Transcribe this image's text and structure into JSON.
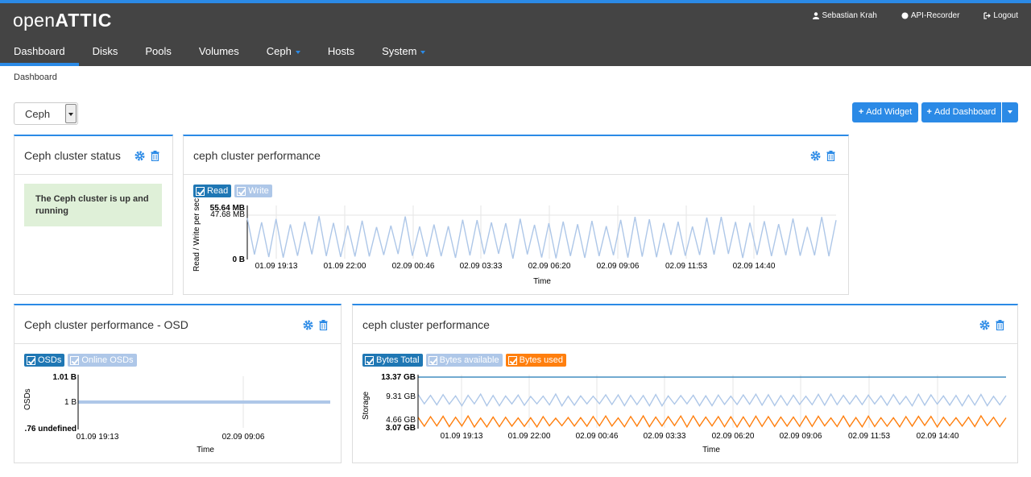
{
  "app": {
    "logo_open": "open",
    "logo_attic": "ATTIC"
  },
  "user_links": {
    "user": "Sebastian Krah",
    "recorder": "API-Recorder",
    "logout": "Logout"
  },
  "nav": {
    "dashboard": "Dashboard",
    "disks": "Disks",
    "pools": "Pools",
    "volumes": "Volumes",
    "ceph": "Ceph",
    "hosts": "Hosts",
    "system": "System"
  },
  "breadcrumb": "Dashboard",
  "dashboard_select": "Ceph",
  "buttons": {
    "add_widget": "Add Widget",
    "add_dashboard": "Add Dashboard"
  },
  "widgets": {
    "status": {
      "title": "Ceph cluster status",
      "message": "The Ceph cluster is up and running"
    },
    "perf1": {
      "title": "ceph cluster performance",
      "legend": [
        "Read",
        "Write"
      ]
    },
    "osd": {
      "title": "Ceph cluster performance - OSD",
      "legend": [
        "OSDs",
        "Online OSDs"
      ]
    },
    "perf2": {
      "title": "ceph cluster performance",
      "legend": [
        "Bytes Total",
        "Bytes available",
        "Bytes used"
      ]
    }
  },
  "colors": {
    "accent": "#2b8ae6",
    "topbar": "#444444",
    "series_dark": "#1f77b4",
    "series_light": "#aec7e8",
    "series_orange": "#ff7f0e",
    "success_bg": "#dff0d8"
  },
  "chart_data": [
    {
      "type": "line",
      "ylabel": "Read / Write per sec",
      "xlabel": "Time",
      "ytick_labels": [
        "55.64 MB",
        "47.68 MB",
        "0 B"
      ],
      "xtick_labels": [
        "01.09 19:13",
        "01.09 22:00",
        "02.09 00:46",
        "02.09 03:33",
        "02.09 06:20",
        "02.09 09:06",
        "02.09 11:53",
        "02.09 14:40"
      ],
      "ylim_mb": [
        0,
        55.64
      ],
      "series": [
        {
          "name": "Read",
          "enabled": true,
          "min_mb": 0,
          "max_mb": 55.64,
          "oscillations": 82
        },
        {
          "name": "Write",
          "enabled": false
        }
      ]
    },
    {
      "type": "line",
      "ylabel": "OSDs",
      "xlabel": "Time",
      "ytick_labels": [
        "1.01 B",
        "1 B",
        ".76 undefined"
      ],
      "xtick_labels": [
        "01.09 19:13",
        "02.09 09:06"
      ],
      "series": [
        {
          "name": "OSDs",
          "enabled": true,
          "constant": 1
        },
        {
          "name": "Online OSDs",
          "enabled": false
        }
      ]
    },
    {
      "type": "line",
      "ylabel": "Storage",
      "xlabel": "Time",
      "ytick_labels": [
        "13.37 GB",
        "9.31 GB",
        "4.66 GB",
        "3.07 GB"
      ],
      "xtick_labels": [
        "01.09 19:13",
        "01.09 22:00",
        "02.09 00:46",
        "02.09 03:33",
        "02.09 06:20",
        "02.09 09:06",
        "02.09 11:53",
        "02.09 14:40"
      ],
      "ylim_gb": [
        3.07,
        13.37
      ],
      "series": [
        {
          "name": "Bytes Total",
          "enabled": true,
          "constant_gb": 13.37
        },
        {
          "name": "Bytes available",
          "enabled": true,
          "min_gb": 7.9,
          "max_gb": 9.5,
          "oscillations": 94
        },
        {
          "name": "Bytes used",
          "enabled": true,
          "min_gb": 3.1,
          "max_gb": 4.7,
          "oscillations": 94
        }
      ]
    }
  ]
}
